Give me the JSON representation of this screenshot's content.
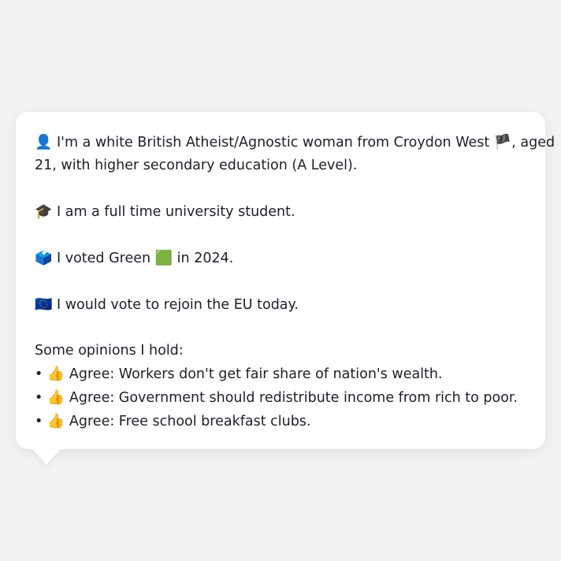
{
  "profile": {
    "identity": {
      "icon": "👤",
      "text_before_flag": "I'm a white British Atheist/Agnostic woman from Croydon West",
      "flag": "🏴",
      "text_after_flag": ", aged",
      "line2": "21, with higher secondary education (A Level)."
    },
    "occupation": {
      "icon": "🎓",
      "text": "I am a full time university student."
    },
    "vote": {
      "icon": "🗳️",
      "text_before": "I voted Green",
      "party_icon": "🟩",
      "text_after": "in 2024."
    },
    "eu": {
      "icon": "🇪🇺",
      "text": "I would vote to rejoin the EU today."
    },
    "opinions": {
      "heading": "Some opinions I hold:",
      "bullet": "•",
      "thumb": "👍",
      "items": [
        "Agree: Workers don't get fair share of nation's wealth.",
        "Agree: Government should redistribute income from rich to poor.",
        "Agree: Free school breakfast clubs."
      ]
    }
  }
}
